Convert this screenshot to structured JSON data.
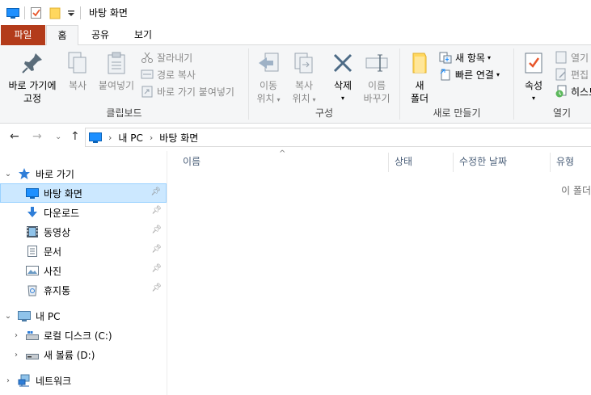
{
  "window": {
    "title": "바탕 화면"
  },
  "tabs": [
    {
      "label": "파일"
    },
    {
      "label": "홈"
    },
    {
      "label": "공유"
    },
    {
      "label": "보기"
    }
  ],
  "ribbon": {
    "clipboard": {
      "label": "클립보드",
      "pin_quick": "바로 가기에\n고정",
      "copy": "복사",
      "paste": "붙여넣기",
      "cut": "잘라내기",
      "copy_path": "경로 복사",
      "paste_shortcut": "바로 가기 붙여넣기"
    },
    "organize": {
      "label": "구성",
      "move_to": "이동\n위치",
      "copy_to": "복사\n위치",
      "delete": "삭제",
      "rename": "이름\n바꾸기"
    },
    "new": {
      "label": "새로 만들기",
      "new_folder": "새\n폴더",
      "new_item": "새 항목",
      "easy_access": "빠른 연결"
    },
    "open": {
      "label": "열기",
      "properties": "속성",
      "open": "열기",
      "edit": "편집",
      "history": "히스토"
    }
  },
  "address": {
    "crumbs": [
      "내 PC",
      "바탕 화면"
    ]
  },
  "navpane": {
    "quick_access": "바로 가기",
    "quick_items": [
      {
        "label": "바탕 화면",
        "icon": "desktop-icon"
      },
      {
        "label": "다운로드",
        "icon": "download-icon"
      },
      {
        "label": "동영상",
        "icon": "video-icon"
      },
      {
        "label": "문서",
        "icon": "document-icon"
      },
      {
        "label": "사진",
        "icon": "picture-icon"
      },
      {
        "label": "휴지통",
        "icon": "recycle-bin-icon"
      }
    ],
    "this_pc": "내 PC",
    "drives": [
      {
        "label": "로컬 디스크 (C:)"
      },
      {
        "label": "새 볼륨 (D:)"
      }
    ],
    "network": "네트워크"
  },
  "content": {
    "columns": [
      "이름",
      "상태",
      "수정한 날짜",
      "유형"
    ],
    "empty_message": "이 폴더"
  },
  "colors": {
    "file_tab": "#b33b1a",
    "selected_bg": "#cce8ff",
    "ribbon_bg": "#f5f6f7",
    "accent_blue": "#1e90ff"
  }
}
